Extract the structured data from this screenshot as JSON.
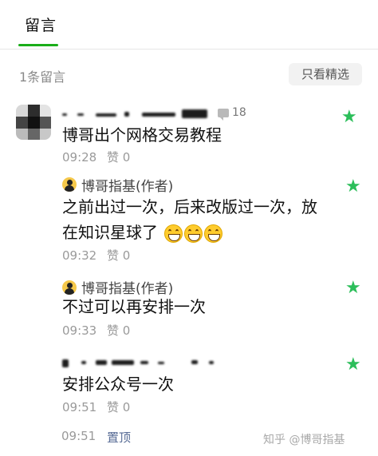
{
  "tab": {
    "title": "留言"
  },
  "header": {
    "count_text": "1条留言",
    "filter_label": "只看精选"
  },
  "comments": [
    {
      "name": "",
      "reply_count": "18",
      "text": "博哥出个网格交易教程",
      "time": "09:28",
      "like": "赞 0"
    },
    {
      "name": "博哥指基(作者)",
      "text_line1": "之前出过一次，后来改版过一次，放",
      "text_line2": "在知识星球了",
      "time": "09:32",
      "like": "赞 0"
    },
    {
      "name": "博哥指基(作者)",
      "text": "不过可以再安排一次",
      "time": "09:33",
      "like": "赞 0"
    },
    {
      "name": "",
      "text": "安排公众号一次",
      "time": "09:51",
      "like": "赞 0"
    }
  ],
  "footer": {
    "time": "09:51",
    "pin_label": "置顶"
  },
  "watermark": "知乎 @博哥指基",
  "colors": {
    "accent_green": "#1aad19",
    "star_green": "#2cbe5a",
    "link_blue": "#576b95"
  }
}
